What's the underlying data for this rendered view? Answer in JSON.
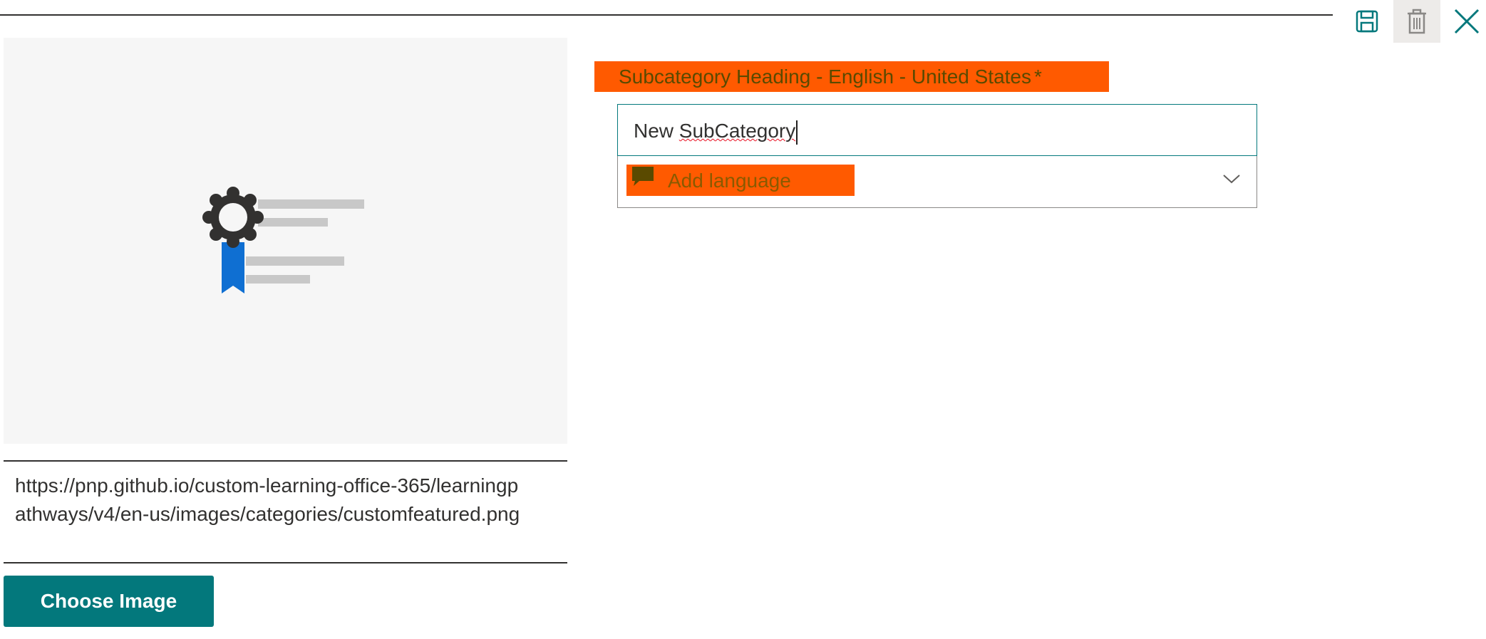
{
  "toolbar": {
    "save_icon": "save-icon",
    "delete_icon": "trash-icon",
    "close_icon": "close-icon"
  },
  "image_panel": {
    "placeholder_icon": "certificate-ribbon-icon",
    "url": "https://pnp.github.io/custom-learning-office-365/learningpathways/v4/en-us/images/categories/customfeatured.png",
    "choose_button_label": "Choose Image"
  },
  "heading_field": {
    "label": "Subcategory Heading - English - United States",
    "required_marker": "*",
    "value_prefix": "New ",
    "value_misspelled": "SubCategory"
  },
  "language_dropdown": {
    "icon": "speech-bubble-icon",
    "label": "Add language",
    "chevron": "chevron-down-icon"
  },
  "colors": {
    "accent": "#03787c",
    "highlight": "#ff5a00",
    "preview_bg": "#f6f6f6",
    "ribbon_blue": "#0f6fd2"
  }
}
